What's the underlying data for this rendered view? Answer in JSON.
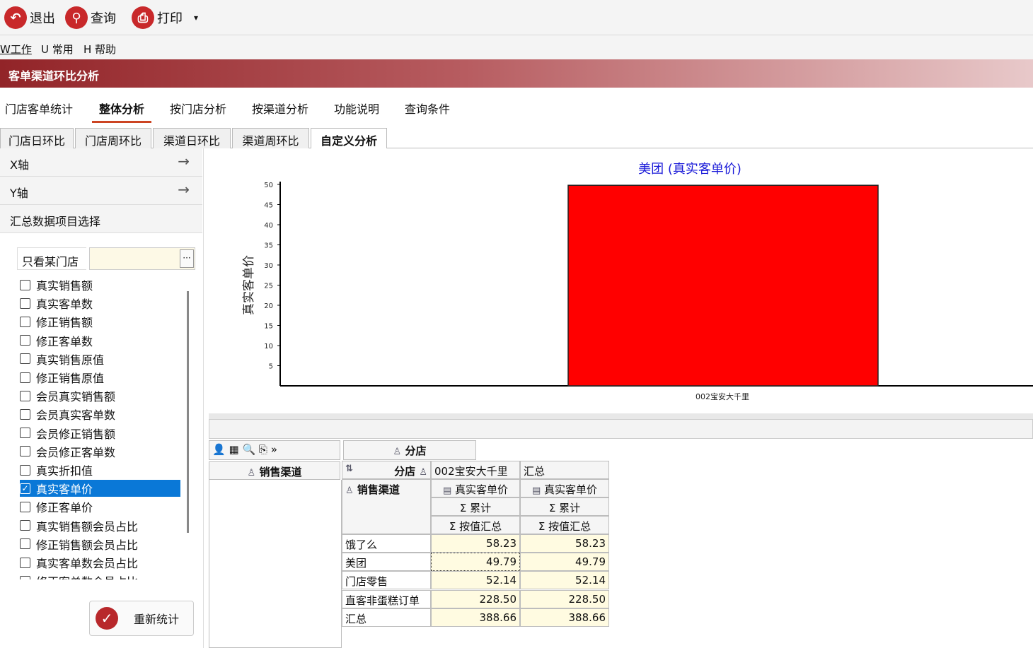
{
  "toolbar": {
    "exit_label": "退出",
    "query_label": "查询",
    "print_label": "打印",
    "print_dropdown": "▾"
  },
  "menubar": {
    "items": [
      "W工作",
      "U 常用",
      "H 帮助"
    ]
  },
  "window_title": "客单渠道环比分析",
  "tabs_main": [
    "门店客单统计",
    "整体分析",
    "按门店分析",
    "按渠道分析",
    "功能说明",
    "查询条件"
  ],
  "tabs_sub": [
    "门店日环比",
    "门店周环比",
    "渠道日环比",
    "渠道周环比",
    "自定义分析"
  ],
  "left_panel": {
    "x_axis_label": "X轴",
    "y_axis_label": "Y轴",
    "summary_label": "汇总数据项目选择",
    "store_filter_label": "只看某门店",
    "store_filter_value": "",
    "dots": "···",
    "metrics": [
      {
        "label": "真实销售额",
        "checked": false
      },
      {
        "label": "真实客单数",
        "checked": false
      },
      {
        "label": "修正销售额",
        "checked": false
      },
      {
        "label": "修正客单数",
        "checked": false
      },
      {
        "label": "真实销售原值",
        "checked": false
      },
      {
        "label": "修正销售原值",
        "checked": false
      },
      {
        "label": "会员真实销售额",
        "checked": false
      },
      {
        "label": "会员真实客单数",
        "checked": false
      },
      {
        "label": "会员修正销售额",
        "checked": false
      },
      {
        "label": "会员修正客单数",
        "checked": false
      },
      {
        "label": "真实折扣值",
        "checked": false
      },
      {
        "label": "真实客单价",
        "checked": true
      },
      {
        "label": "修正客单价",
        "checked": false
      },
      {
        "label": "真实销售额会员占比",
        "checked": false
      },
      {
        "label": "修正销售额会员占比",
        "checked": false
      },
      {
        "label": "真实客单数会员占比",
        "checked": false
      },
      {
        "label": "修正客单数会员占比",
        "checked": false
      }
    ],
    "recalc_label": "重新统计"
  },
  "chart_data": {
    "type": "bar",
    "title": "美团 (真实客单价)",
    "ylabel": "真实客单价",
    "xlabel": "",
    "categories": [
      "002宝安大千里"
    ],
    "values": [
      49.79
    ],
    "ylim": [
      0,
      50
    ],
    "yticks": [
      5,
      10,
      15,
      20,
      25,
      30,
      35,
      40,
      45,
      50
    ],
    "bar_color": "#ff0000",
    "grid": false
  },
  "pivot": {
    "col_field": "分店",
    "row_field": "销售渠道",
    "data_field_header": "分店",
    "columns": [
      "002宝安大千里",
      "汇总"
    ],
    "measure": "真实客单价",
    "agg1": "Σ 累计",
    "agg2": "Σ 按值汇总",
    "row_header": "销售渠道",
    "rows": [
      {
        "label": "饿了么",
        "v1": "58.23",
        "v2": "58.23"
      },
      {
        "label": "美团",
        "v1": "49.79",
        "v2": "49.79"
      },
      {
        "label": "门店零售",
        "v1": "52.14",
        "v2": "52.14"
      },
      {
        "label": "直客非蛋糕订单",
        "v1": "228.50",
        "v2": "228.50"
      },
      {
        "label": "汇总",
        "v1": "388.66",
        "v2": "388.66"
      }
    ]
  },
  "colors": {
    "brand_red": "#c8282a",
    "selection_blue": "#0a78d7",
    "chart_title_blue": "#1a1ad8"
  }
}
